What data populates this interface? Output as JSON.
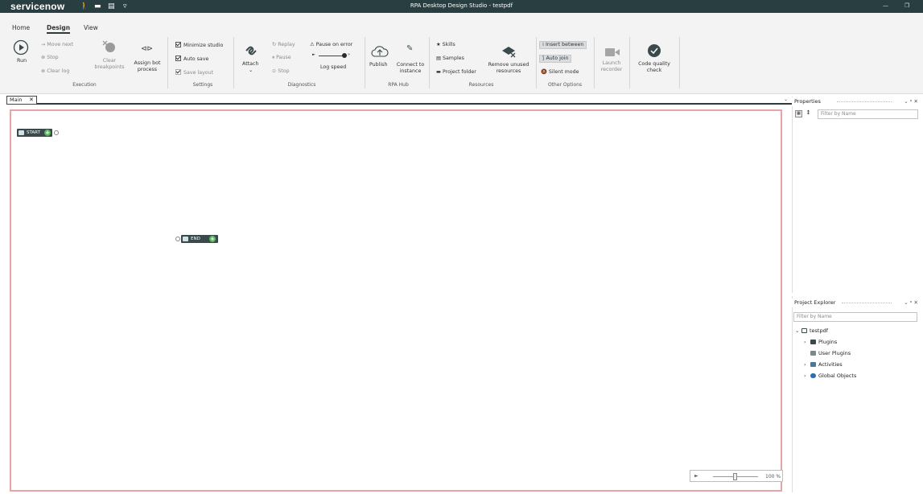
{
  "titlebar": {
    "logo": "servicenow",
    "quick_icons": [
      "🚶",
      "▬",
      "▤",
      "▿"
    ],
    "title": "RPA Desktop Design Studio - testpdf",
    "minimize": "—",
    "restore": "❐"
  },
  "ribbon": {
    "tabs": [
      "Home",
      "Design",
      "View"
    ],
    "execution": {
      "run": "Run",
      "move_next": "Move next",
      "stop": "Stop",
      "clear_log": "Clear log",
      "clear_breakpoints": "Clear breakpoints",
      "assign_bot_process": "Assign bot process",
      "label": "Execution"
    },
    "settings": {
      "minimize_studio": "Minimize studio",
      "auto_save": "Auto save",
      "save_layout": "Save layout",
      "label": "Settings"
    },
    "diagnostics": {
      "attach": "Attach",
      "replay": "Replay",
      "pause": "Pause",
      "stop": "Stop",
      "pause_on_error": "Pause on error",
      "log_speed": "Log speed",
      "label": "Diagnostics"
    },
    "rpa_hub": {
      "publish": "Publish",
      "connect_to_instance": "Connect to instance",
      "label": "RPA Hub"
    },
    "resources": {
      "skills": "Skills",
      "samples": "Samples",
      "project_folder": "Project folder",
      "remove_unused_resources": "Remove unused resources",
      "label": "Resources"
    },
    "other_options": {
      "insert_between": "Insert between",
      "auto_join": "Auto join",
      "silent_mode": "Silent mode",
      "label": "Other Options"
    },
    "launch_recorder": "Launch recorder",
    "code_quality_check": "Code quality check"
  },
  "doc_tabs": {
    "main": "Main",
    "close": "✕",
    "dropdown": "⌄"
  },
  "canvas": {
    "start_node": "START",
    "end_node": "END",
    "zoom_value": "100 %",
    "zoom_fraction": 0.5
  },
  "properties": {
    "title": "Properties",
    "controls": "⌄ ᵖ ✕",
    "filter_placeholder": "Filter by Name"
  },
  "project_explorer": {
    "title": "Project Explorer",
    "controls": "⌄ ᵖ ✕",
    "filter_placeholder": "Filter by Name",
    "root": "testpdf",
    "items": [
      "Plugins",
      "User Plugins",
      "Activities",
      "Global Objects"
    ]
  },
  "colors": {
    "titlebar": "#293e40",
    "node": "#3a4a4c",
    "add": "#5cb85c",
    "canvas_border": "#e8a5a5"
  }
}
